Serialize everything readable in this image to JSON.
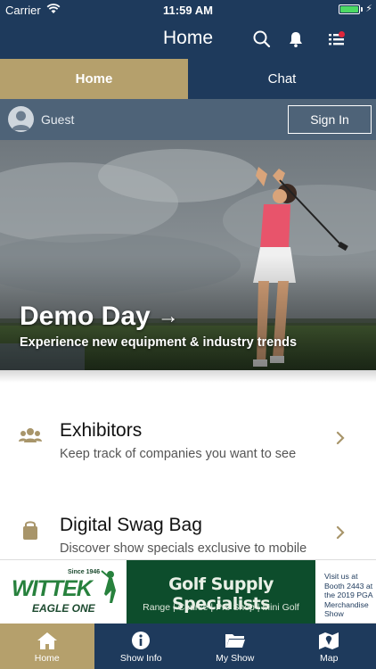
{
  "status_bar": {
    "carrier": "Carrier",
    "time": "11:59 AM",
    "battery_icon": "battery-charging-icon",
    "wifi_icon": "wifi-icon"
  },
  "nav_bar": {
    "title": "Home",
    "search_icon": "search-icon",
    "notifications_icon": "bell-icon",
    "menu_icon": "list-icon",
    "badge_color": "#e0263c"
  },
  "top_tabs": [
    {
      "label": "Home",
      "active": true
    },
    {
      "label": "Chat",
      "active": false
    }
  ],
  "guest_bar": {
    "user_label": "Guest",
    "sign_in_label": "Sign In"
  },
  "hero": {
    "title": "Demo Day",
    "arrow": "→",
    "subtitle": "Experience new equipment & industry trends"
  },
  "menu": [
    {
      "icon": "people-icon",
      "title": "Exhibitors",
      "subtitle": "Keep track of companies you want to see"
    },
    {
      "icon": "shopping-bag-icon",
      "title": "Digital Swag Bag",
      "subtitle": "Discover show specials exclusive to mobile"
    }
  ],
  "ad_banner": {
    "brand": "WITTEK",
    "brand_sub": "EAGLE ONE",
    "since": "Since 1946",
    "headline": "Golf Supply Specialists",
    "services": "Range | Course | Pro Shop | Mini Golf",
    "side_text": "Visit us at Booth 2443 at the 2019 PGA Merchandise Show"
  },
  "bottom_tabs": [
    {
      "label": "Home",
      "icon": "home-icon",
      "active": true
    },
    {
      "label": "Show Info",
      "icon": "info-icon",
      "active": false
    },
    {
      "label": "My Show",
      "icon": "folder-icon",
      "active": false
    },
    {
      "label": "Map",
      "icon": "map-icon",
      "active": false
    }
  ],
  "colors": {
    "navy": "#1e3a5c",
    "gold": "#b5a06c",
    "slate": "#4e6378",
    "ad_green": "#0d4d2c"
  }
}
